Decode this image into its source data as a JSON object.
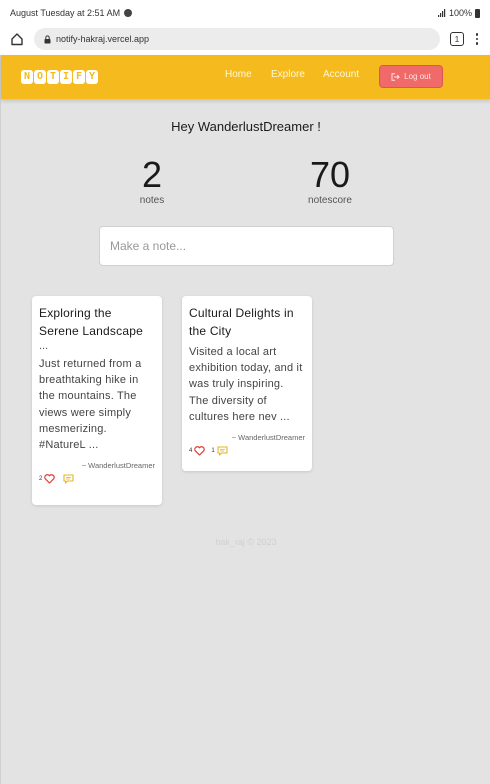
{
  "statusbar": {
    "time": "August Tuesday at 2:51 AM",
    "battery": "100%"
  },
  "browser": {
    "url": "notify-hakraj.vercel.app",
    "tab_count": "1"
  },
  "navbar": {
    "logo": [
      "N",
      "O",
      "T",
      "I",
      "F",
      "Y"
    ],
    "links": [
      "Home",
      "Explore",
      "Account"
    ],
    "logout_label": "Log out"
  },
  "greeting": "Hey WanderlustDreamer !",
  "stats": {
    "notes_value": "2",
    "notes_label": "notes",
    "score_value": "70",
    "score_label": "notescore"
  },
  "note_input": {
    "placeholder": "Make a note..."
  },
  "notes": [
    {
      "title": "Exploring the Serene Landscape",
      "title_suffix": "...",
      "body": "Just returned from a breathtaking hike in the mountains. The views were simply mesmerizing. #NatureL ...",
      "author": "~ WanderlustDreamer",
      "likes": "2",
      "comments": ""
    },
    {
      "title": "Cultural Delights in the City",
      "title_suffix": "",
      "body": "Visited a local art exhibition today, and it was truly inspiring. The diversity of cultures here nev ...",
      "author": "~ WanderlustDreamer",
      "likes": "4",
      "comments": "1"
    }
  ],
  "footer": "hak_raj © 2023",
  "colors": {
    "brand": "#f5bb1e",
    "logout": "#f16a6a",
    "heart": "#e53935",
    "comment": "#e7b51c"
  }
}
